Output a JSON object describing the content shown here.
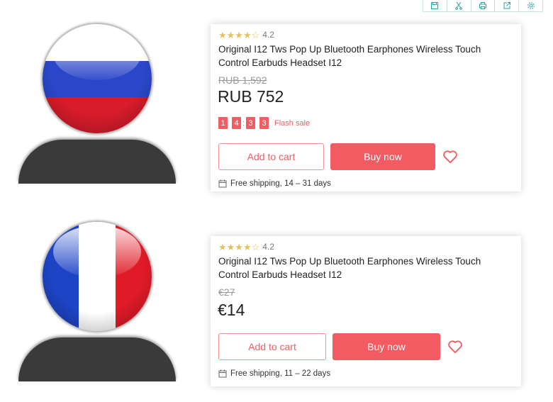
{
  "toolbar": {
    "icons": [
      "save-icon",
      "scissors-icon",
      "print-icon",
      "share-icon",
      "settings-icon"
    ]
  },
  "products": [
    {
      "avatar_flag": "russia",
      "rating": "4.2",
      "title": "Original I12 Tws Pop Up Bluetooth Earphones Wireless Touch Control Earbuds Headset I12",
      "old_price": "RUB 1,592",
      "price": "RUB 752",
      "timer": [
        "1",
        "4",
        "3",
        "3"
      ],
      "flash_sale": "Flash sale",
      "add_to_cart": "Add to cart",
      "buy_now": "Buy now",
      "shipping": "Free shipping, 14 – 31 days"
    },
    {
      "avatar_flag": "france",
      "rating": "4.2",
      "title": "Original I12 Tws Pop Up Bluetooth Earphones Wireless Touch Control Earbuds Headset I12",
      "old_price": "€27",
      "price": "€14",
      "add_to_cart": "Add to cart",
      "buy_now": "Buy now",
      "shipping": "Free shipping, 11 – 22 days"
    }
  ],
  "colors": {
    "accent": "#f35b62",
    "star": "#e1c25b"
  }
}
